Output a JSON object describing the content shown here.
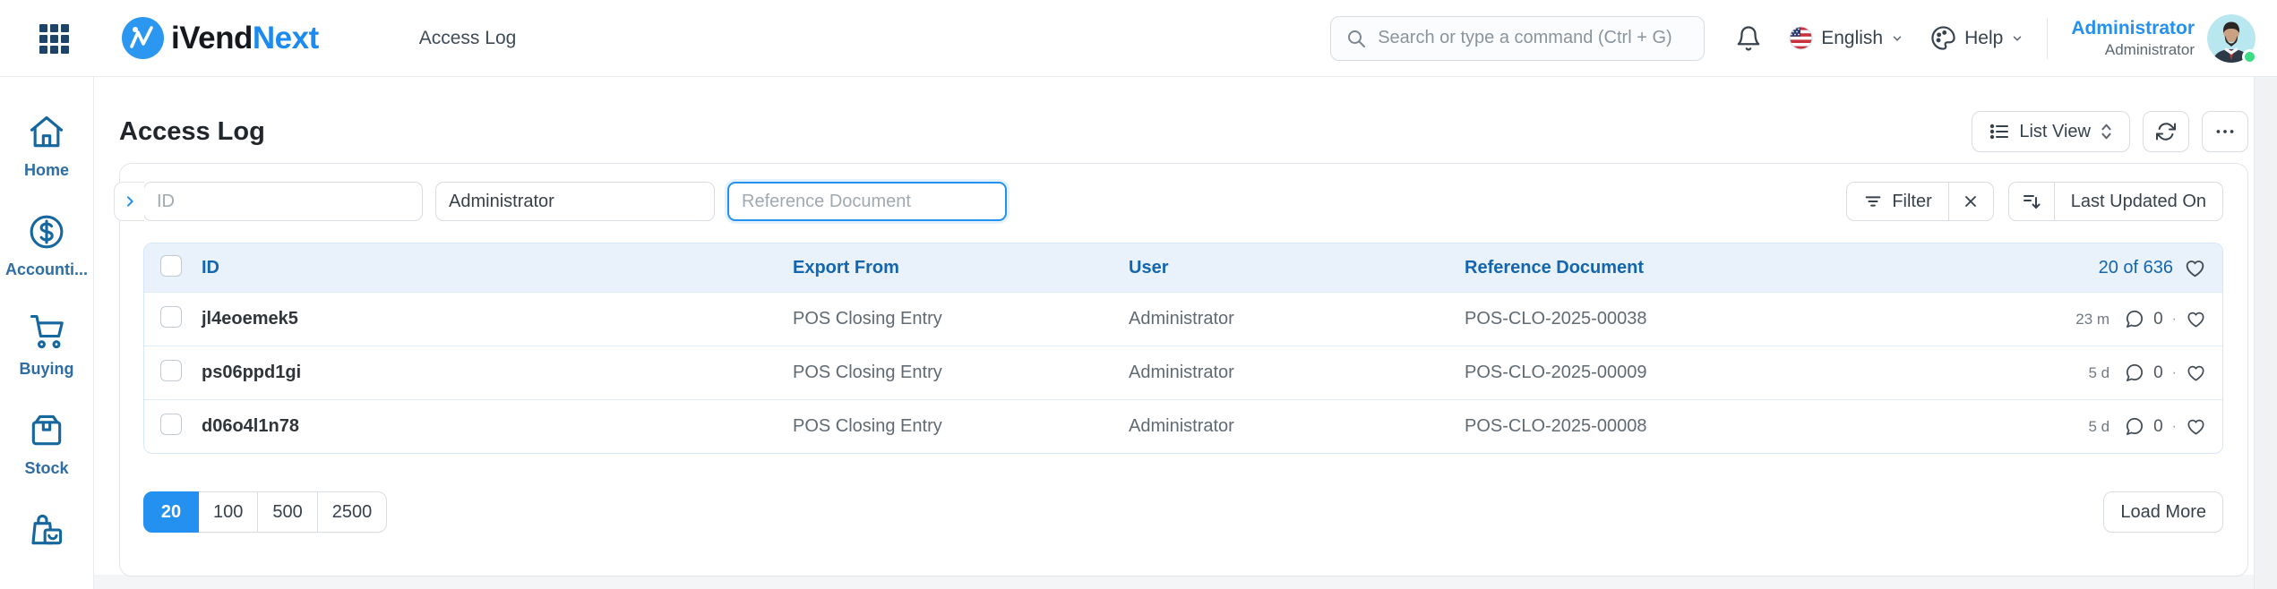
{
  "colors": {
    "accent": "#2490ef",
    "brand_blue": "#1d8af0",
    "header_text_blue": "#1366ae",
    "header_row_bg": "#e9f1fb",
    "status_online": "#3ddc84",
    "navy_grid": "#1f4368"
  },
  "navbar": {
    "brand_black": "iVend",
    "brand_blue": "Next",
    "breadcrumb": "Access Log",
    "search_placeholder": "Search or type a command (Ctrl + G)",
    "language": "English",
    "help": "Help",
    "user": {
      "name": "Administrator",
      "role": "Administrator"
    }
  },
  "sidebar": {
    "items": [
      {
        "label": "Home",
        "icon": "home-icon"
      },
      {
        "label": "Accounti...",
        "icon": "accounting-icon"
      },
      {
        "label": "Buying",
        "icon": "cart-icon"
      },
      {
        "label": "Stock",
        "icon": "box-icon"
      },
      {
        "label": "",
        "icon": "bag-icon"
      }
    ]
  },
  "page": {
    "title": "Access Log",
    "view_switcher": "List View",
    "filters": {
      "id_placeholder": "ID",
      "user_value": "Administrator",
      "reference_placeholder": "Reference Document",
      "filter_label": "Filter",
      "sort_label": "Last Updated On"
    },
    "table": {
      "columns": {
        "id": "ID",
        "export_from": "Export From",
        "user": "User",
        "reference": "Reference Document"
      },
      "count": "20 of 636",
      "rows": [
        {
          "id": "jl4eoemek5",
          "export_from": "POS Closing Entry",
          "user": "Administrator",
          "reference": "POS-CLO-2025-00038",
          "modified": "23 m",
          "comments": "0",
          "dot": "·"
        },
        {
          "id": "ps06ppd1gi",
          "export_from": "POS Closing Entry",
          "user": "Administrator",
          "reference": "POS-CLO-2025-00009",
          "modified": "5 d",
          "comments": "0",
          "dot": "·"
        },
        {
          "id": "d06o4l1n78",
          "export_from": "POS Closing Entry",
          "user": "Administrator",
          "reference": "POS-CLO-2025-00008",
          "modified": "5 d",
          "comments": "0",
          "dot": "·"
        }
      ]
    },
    "pagination": {
      "options": {
        "0": "20",
        "1": "100",
        "2": "500",
        "3": "2500"
      },
      "selected": "20",
      "load_more": "Load More"
    }
  }
}
